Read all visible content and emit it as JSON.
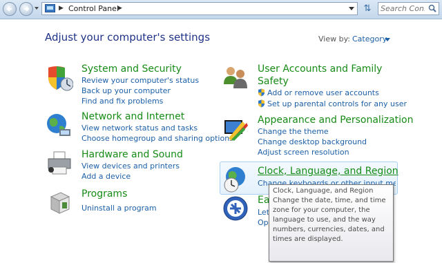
{
  "address_bar": {
    "breadcrumb": "Control Panel",
    "search_placeholder": "Search Con..."
  },
  "main": {
    "heading": "Adjust your computer's settings",
    "view_by_label": "View by:",
    "view_by_value": "Category"
  },
  "categories": {
    "system_security": {
      "title": "System and Security",
      "links": [
        "Review your computer's status",
        "Back up your computer",
        "Find and fix problems"
      ]
    },
    "network": {
      "title": "Network and Internet",
      "links": [
        "View network status and tasks",
        "Choose homegroup and sharing options"
      ]
    },
    "hardware": {
      "title": "Hardware and Sound",
      "links": [
        "View devices and printers",
        "Add a device"
      ]
    },
    "programs": {
      "title": "Programs",
      "links": [
        "Uninstall a program"
      ]
    },
    "user_accounts": {
      "title_line1": "User Accounts and Family",
      "title_line2": "Safety",
      "links": [
        "Add or remove user accounts",
        "Set up parental controls for any user"
      ]
    },
    "appearance": {
      "title": "Appearance and Personalization",
      "links": [
        "Change the theme",
        "Change desktop background",
        "Adjust screen resolution"
      ]
    },
    "clock": {
      "title": "Clock, Language, and Region",
      "links": [
        "Change keyboards or other input methods"
      ]
    },
    "ease": {
      "title_partial": "Ea",
      "links_partial": [
        "Let",
        "Op"
      ]
    }
  },
  "tooltip": {
    "title": "Clock, Language, and Region",
    "body": "Change the date, time, and time zone for your computer, the language to use, and the way numbers, currencies, dates, and times are displayed."
  },
  "icons": {
    "back": "back-arrow-icon",
    "forward": "forward-arrow-icon",
    "refresh": "refresh-icon",
    "search": "search-icon"
  }
}
